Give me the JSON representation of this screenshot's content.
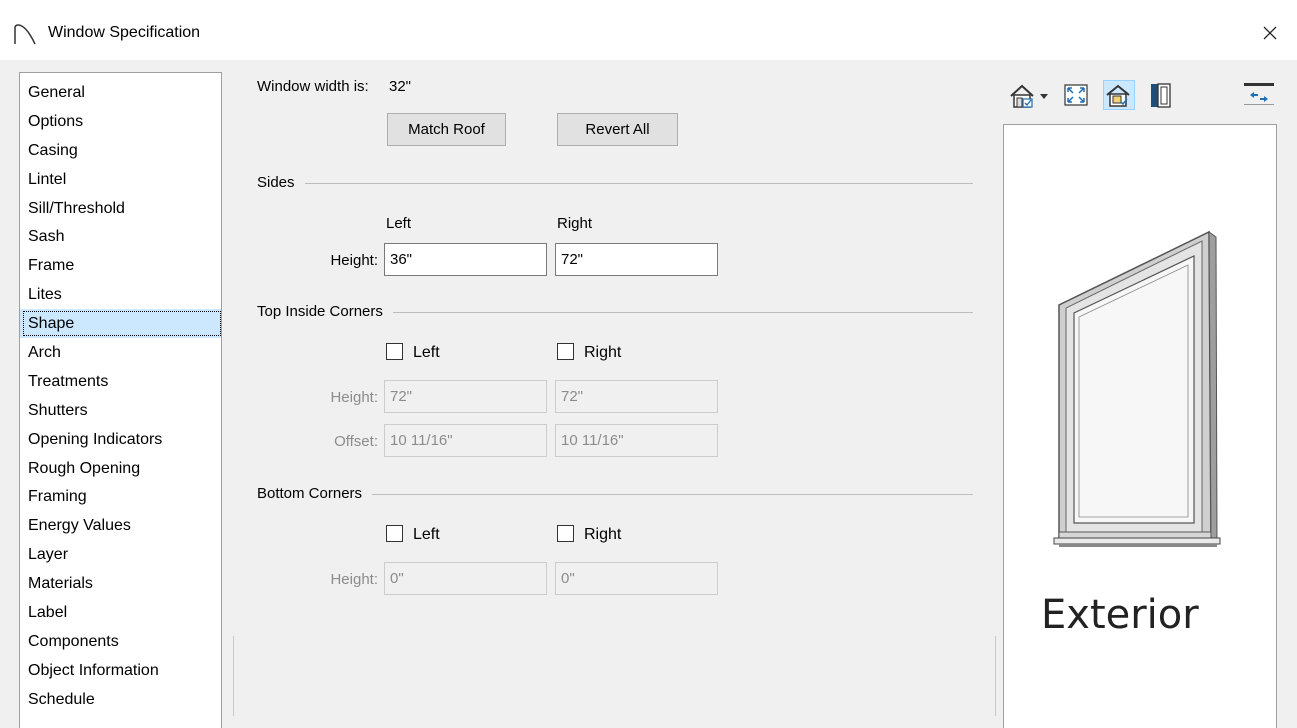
{
  "window": {
    "title": "Window Specification"
  },
  "sidebar": {
    "selected": "Shape",
    "items": [
      "General",
      "Options",
      "Casing",
      "Lintel",
      "Sill/Threshold",
      "Sash",
      "Frame",
      "Lites",
      "Shape",
      "Arch",
      "Treatments",
      "Shutters",
      "Opening Indicators",
      "Rough Opening",
      "Framing",
      "Energy Values",
      "Layer",
      "Materials",
      "Label",
      "Components",
      "Object Information",
      "Schedule"
    ]
  },
  "main": {
    "width_label": "Window width is:",
    "width_value": "32\"",
    "match_roof": "Match Roof",
    "revert_all": "Revert All",
    "sides": {
      "title": "Sides",
      "col_left": "Left",
      "col_right": "Right",
      "height_label": "Height:",
      "left_height": "36\"",
      "right_height": "72\""
    },
    "top_corners": {
      "title": "Top Inside Corners",
      "left_label": "Left",
      "right_label": "Right",
      "height_label": "Height:",
      "offset_label": "Offset:",
      "left_height": "72\"",
      "right_height": "72\"",
      "left_offset": "10 11/16\"",
      "right_offset": "10 11/16\""
    },
    "bottom_corners": {
      "title": "Bottom Corners",
      "left_label": "Left",
      "right_label": "Right",
      "height_label": "Height:",
      "left_height": "0\"",
      "right_height": "0\""
    }
  },
  "preview": {
    "view_label": "Exterior",
    "toolbar_icons": [
      "view-mode-icon",
      "dropdown-arrow-icon",
      "fit-view-icon",
      "exterior-view-icon",
      "interior-view-icon",
      "swap-view-icon"
    ]
  },
  "colors": {
    "selection": "#cce8ff",
    "window_frame": "#c8c8c8",
    "glass": "#eaeaea"
  }
}
